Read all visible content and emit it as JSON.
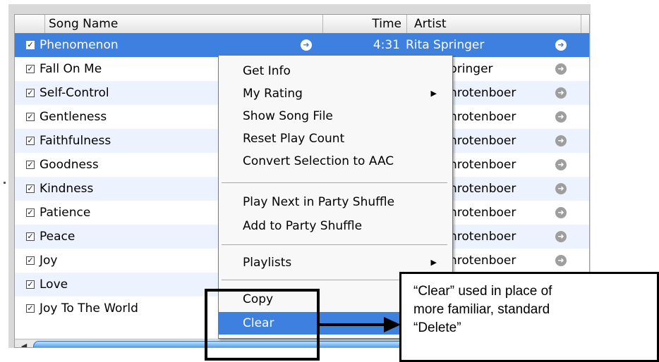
{
  "columns": {
    "song": "Song Name",
    "time": "Time",
    "artist": "Artist"
  },
  "rows": [
    {
      "song": "Phenomenon",
      "time": "4:31",
      "artist": "Rita Springer",
      "checked": true,
      "selected": true
    },
    {
      "song": "Fall On Me",
      "time": "",
      "artist": "pringer",
      "checked": true
    },
    {
      "song": "Self-Control",
      "time": "",
      "artist": "hrotenboer",
      "checked": true
    },
    {
      "song": "Gentleness",
      "time": "",
      "artist": "hrotenboer",
      "checked": true
    },
    {
      "song": "Faithfulness",
      "time": "",
      "artist": "hrotenboer",
      "checked": true
    },
    {
      "song": "Goodness",
      "time": "",
      "artist": "hrotenboer",
      "checked": true
    },
    {
      "song": "Kindness",
      "time": "",
      "artist": "hrotenboer",
      "checked": true
    },
    {
      "song": "Patience",
      "time": "",
      "artist": "hrotenboer",
      "checked": true
    },
    {
      "song": "Peace",
      "time": "",
      "artist": "hrotenboer",
      "checked": true
    },
    {
      "song": "Joy",
      "time": "",
      "artist": "hrotenboer",
      "checked": true
    },
    {
      "song": "Love",
      "time": "",
      "artist": "",
      "checked": true
    },
    {
      "song": "Joy To The World",
      "time": "",
      "artist": "",
      "checked": true
    }
  ],
  "context_menu": {
    "items": [
      "Get Info",
      "My Rating",
      "Show Song File",
      "Reset Play Count",
      "Convert Selection to AAC",
      "Play Next in Party Shuffle",
      "Add to Party Shuffle",
      "Playlists",
      "Copy",
      "Clear"
    ],
    "highlighted": "Clear"
  },
  "annotation": {
    "lines": [
      "“Clear” used in place of",
      "more familiar, standard",
      "“Delete”"
    ]
  },
  "colors": {
    "selection": "#3d80df",
    "row_alt": "#edf3fe",
    "scroll_thumb": "#4f9ee9"
  },
  "icons": {
    "row_checkbox": "checkmark-icon",
    "link_arrow": "arrow-circle-right-icon",
    "submenu": "triangle-right-icon",
    "scroll": "scroll-left-arrow-icon"
  }
}
